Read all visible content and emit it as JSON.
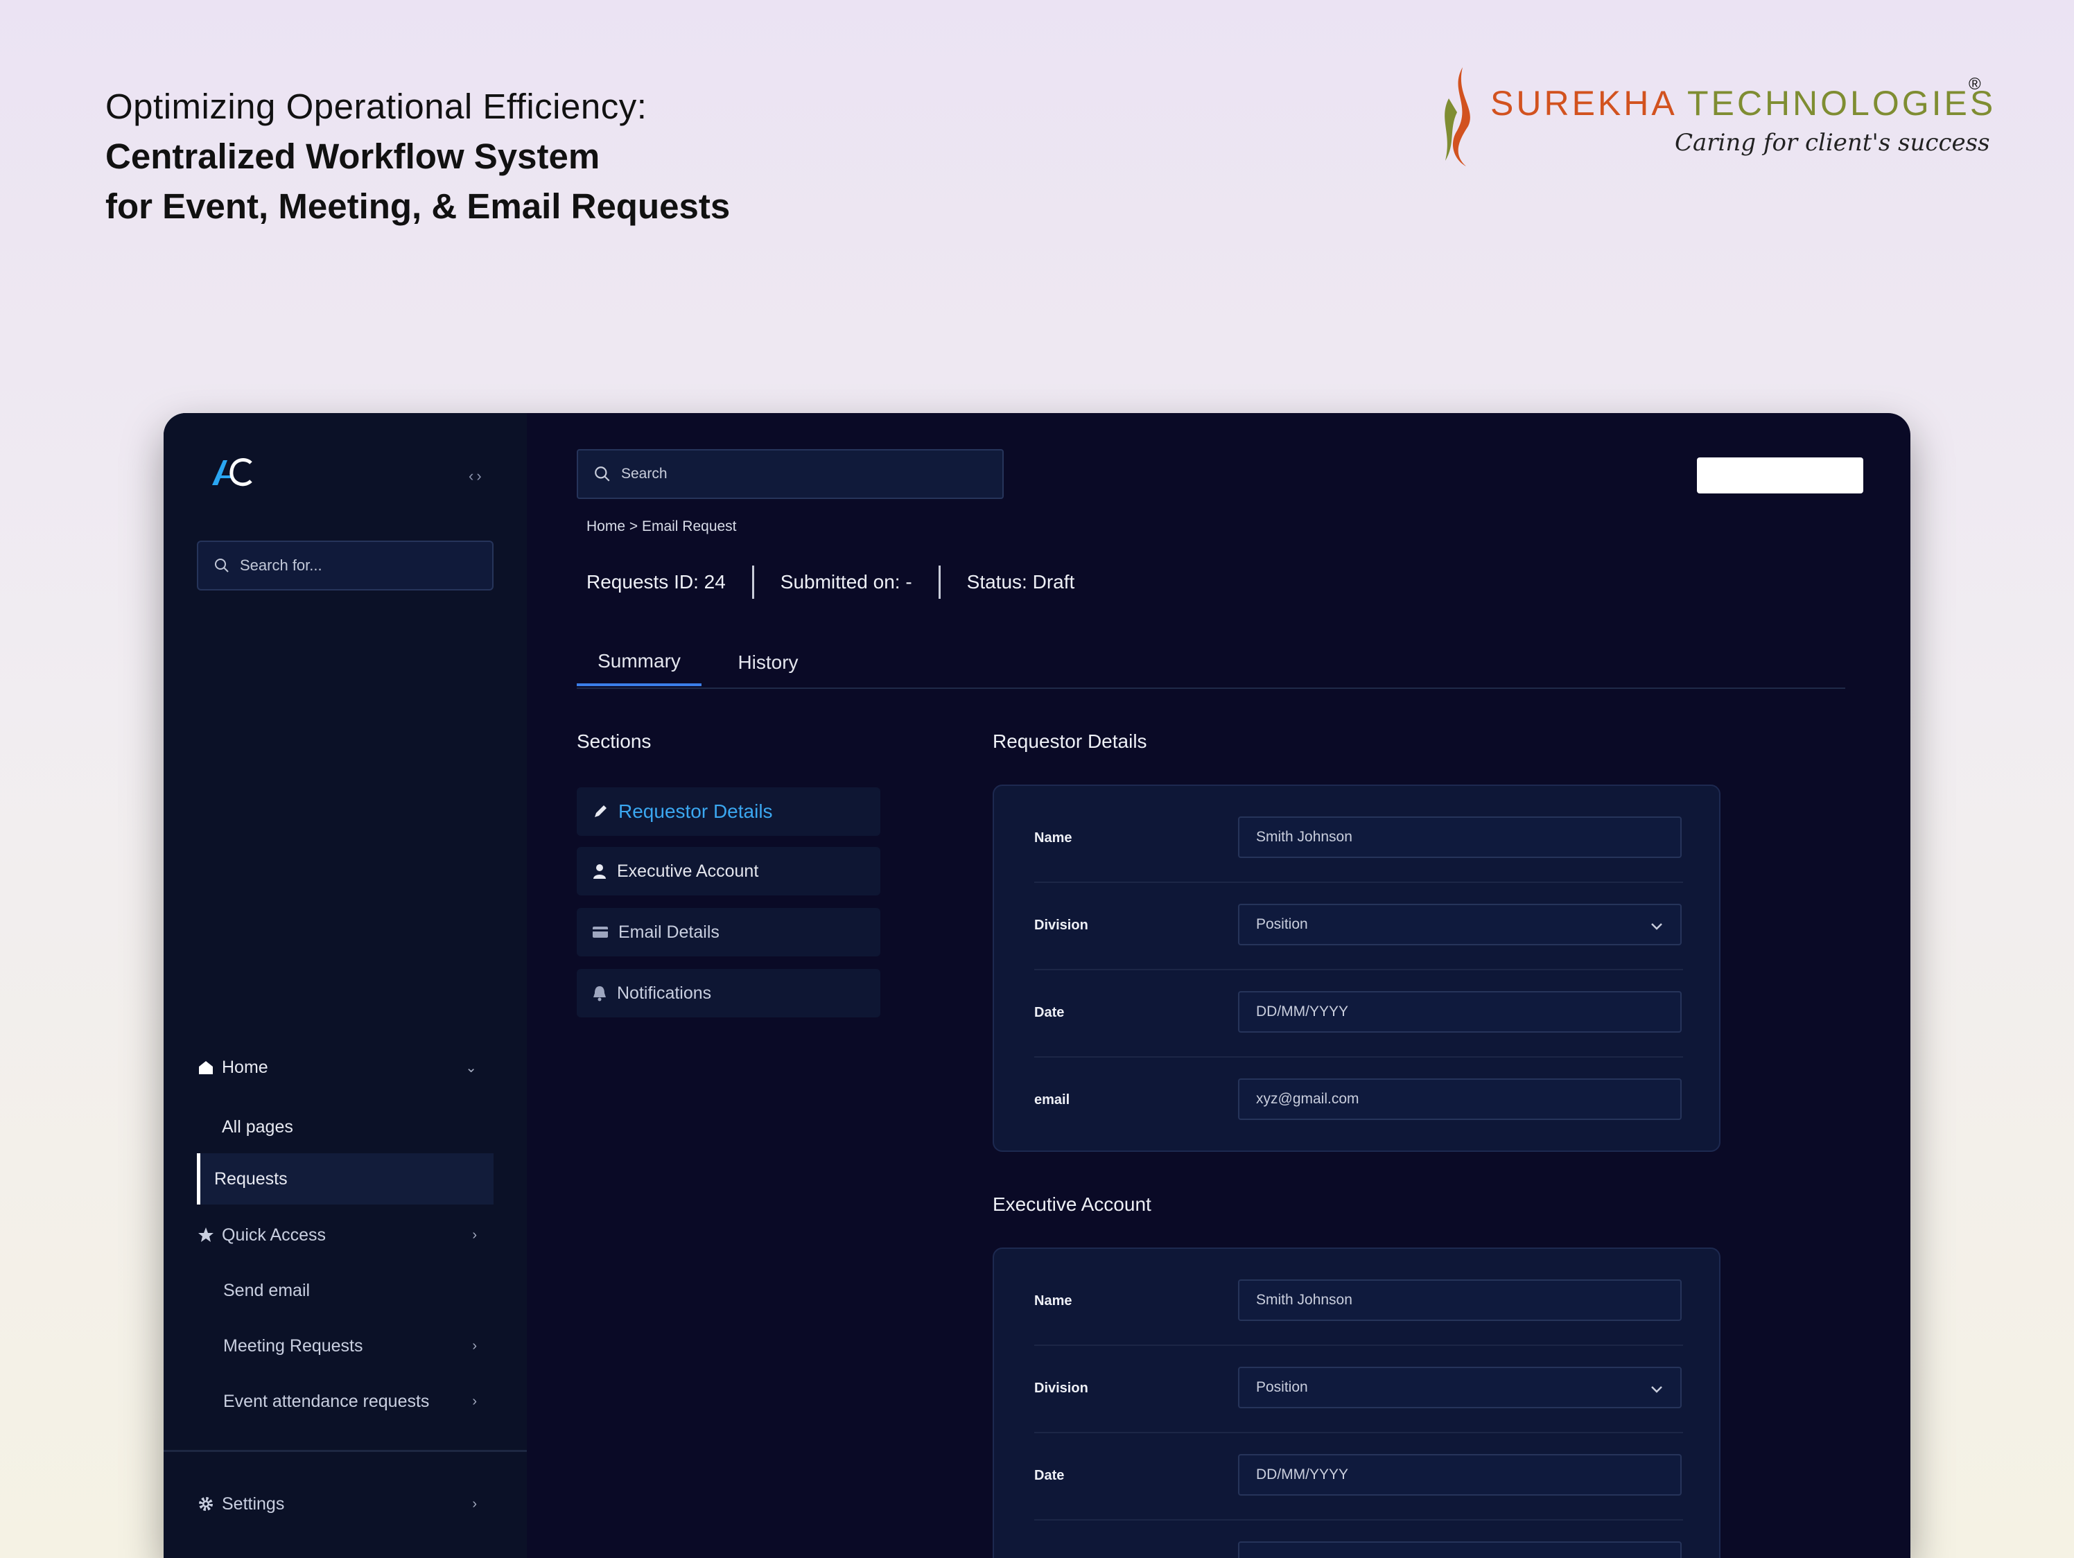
{
  "hero": {
    "line1": "Optimizing Operational Efficiency:",
    "line2": "Centralized Workflow System",
    "line3": "for Event, Meeting, & Email Requests"
  },
  "brand": {
    "name_part1": "SUREKHA ",
    "name_part2": "TECHNOLOGIES",
    "registered": "®",
    "tagline": "Caring for client's success",
    "colors": {
      "primary": "#d2521f",
      "secondary": "#7f8d32"
    }
  },
  "app": {
    "logo_icon": "ac-logo-icon",
    "collapse_icon": "code-brackets-icon",
    "sidebar": {
      "search_placeholder": "Search for...",
      "items": [
        {
          "label": "Home",
          "icon": "home-icon",
          "chevron": "⌄"
        },
        {
          "label": "All pages"
        },
        {
          "label": "Requests"
        },
        {
          "label": "Quick Access",
          "icon": "star-icon",
          "chevron": "›"
        },
        {
          "label": "Send email"
        },
        {
          "label": "Meeting Requests",
          "chevron": "›"
        },
        {
          "label": "Event attendance requests",
          "chevron": "›"
        },
        {
          "label": "Settings",
          "icon": "gear-icon",
          "chevron": "›"
        }
      ]
    },
    "main": {
      "search_placeholder": "Search",
      "breadcrumb": "Home > Email Request",
      "meta": {
        "request_id": "Requests ID:  24",
        "submitted": "Submitted on: -",
        "status": "Status: Draft"
      },
      "tabs": [
        "Summary",
        "History"
      ],
      "sections_title": "Sections",
      "sections": [
        {
          "label": "Requestor Details",
          "icon": "pencil-icon"
        },
        {
          "label": "Executive Account",
          "icon": "user-icon"
        },
        {
          "label": "Email Details",
          "icon": "card-icon"
        },
        {
          "label": "Notifications",
          "icon": "bell-icon"
        }
      ],
      "requestor": {
        "title": "Requestor Details",
        "fields": [
          {
            "label": "Name",
            "value": "Smith Johnson"
          },
          {
            "label": "Division",
            "value": "Position"
          },
          {
            "label": "Date",
            "value": "DD/MM/YYYY"
          },
          {
            "label": "email",
            "value": "xyz@gmail.com"
          }
        ]
      },
      "executive": {
        "title": "Executive Account",
        "fields": [
          {
            "label": "Name",
            "value": "Smith Johnson"
          },
          {
            "label": "Division",
            "value": "Position"
          },
          {
            "label": "Date",
            "value": "DD/MM/YYYY"
          }
        ]
      },
      "accent_color": "#3ba7f0"
    }
  }
}
